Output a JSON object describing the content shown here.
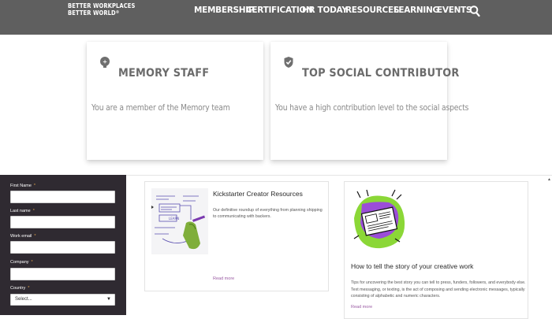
{
  "header": {
    "logo_line1": "BETTER WORKPLACES",
    "logo_line2": "BETTER WORLD",
    "logo_mark": "®",
    "nav": [
      "MEMBERSHIP",
      "CERTIFICATION",
      "HR TODAY",
      "RESOURCES",
      "LEARNING",
      "EVENTS"
    ],
    "search_icon": "search-icon",
    "background": "#5f5f5f"
  },
  "badges": [
    {
      "icon": "memory-brain-icon",
      "title": "MEMORY STAFF",
      "text": "You are a member of the Memory team"
    },
    {
      "icon": "verified-check-icon",
      "title": "TOP SOCIAL CONTRIBUTOR",
      "text": "You have a high contribution level to the social aspects"
    }
  ],
  "form": {
    "background": "#2f2a31",
    "required_mark": "*",
    "fields": [
      {
        "label": "First Name"
      },
      {
        "label": "Last name"
      },
      {
        "label": "Work email"
      },
      {
        "label": "Company"
      }
    ],
    "country": {
      "label": "Country",
      "selected": "Select..."
    }
  },
  "articles": [
    {
      "title": "Kickstarter Creator Resources",
      "description": "Our definitive roundup of everything from planning shipping to communicating with backers.",
      "read_more": "Read more"
    },
    {
      "title": "How to tell the story of your creative work",
      "description": "Tips for uncovering the best story you can tell to press, funders, followers, and everybody else. Text messaging, or texting, is the act of composing and sending electronic messages, typically consisting of alphabetic and numeric characters.",
      "read_more": "Read more"
    }
  ],
  "accent_link_color": "#9a5ba3"
}
